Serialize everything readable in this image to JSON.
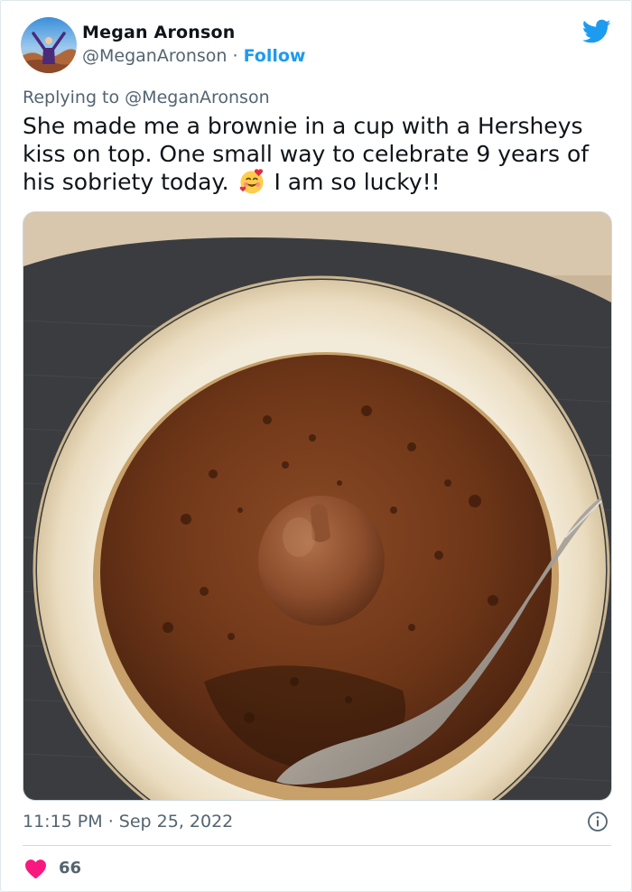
{
  "author": {
    "name": "Megan Aronson",
    "handle": "@MeganAronson",
    "separator": "·",
    "follow_label": "Follow"
  },
  "reply": {
    "prefix": "Replying to",
    "handle": "@MeganAronson"
  },
  "tweet": {
    "text_before_emoji": "She made me a brownie in a cup with a Hersheys kiss on top. One small way to celebrate 9 years of his sobriety today.",
    "emoji": "smiling-face-with-hearts-icon",
    "text_after_emoji": "I am so lucky!!"
  },
  "footer": {
    "time": "11:15 PM",
    "separator": "·",
    "date": "Sep 25, 2022",
    "likes": "66"
  },
  "colors": {
    "accent": "#1d9bf0",
    "like": "#f91880",
    "muted": "#536471"
  }
}
